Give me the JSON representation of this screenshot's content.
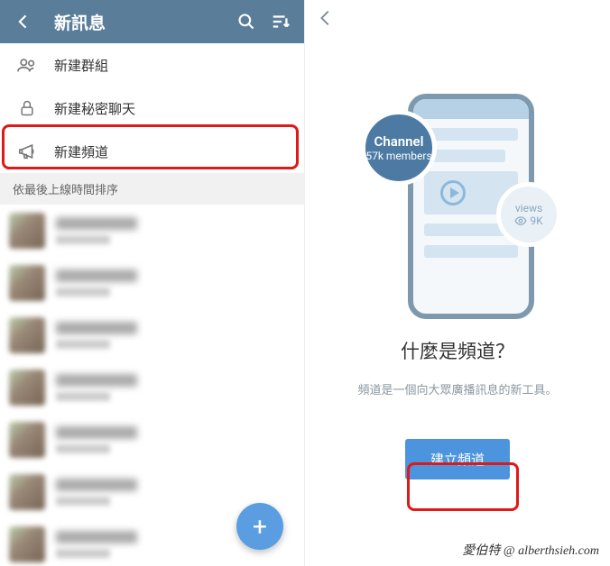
{
  "left": {
    "header_title": "新訊息",
    "menu": [
      {
        "label": "新建群組",
        "icon": "group"
      },
      {
        "label": "新建秘密聊天",
        "icon": "lock"
      },
      {
        "label": "新建頻道",
        "icon": "megaphone",
        "highlighted": true
      }
    ],
    "section_header": "依最後上線時間排序",
    "contacts_count": 7,
    "fab_label": "+"
  },
  "right": {
    "channel_badge_title": "Channel",
    "channel_badge_sub": "57k members",
    "views_badge_title": "views",
    "views_badge_value": "9K",
    "title": "什麼是頻道？",
    "subtitle": "頻道是一個向大眾廣播訊息的新工具。",
    "button_label": "建立頻道"
  },
  "footer": "愛伯特 @ alberthsieh.com"
}
